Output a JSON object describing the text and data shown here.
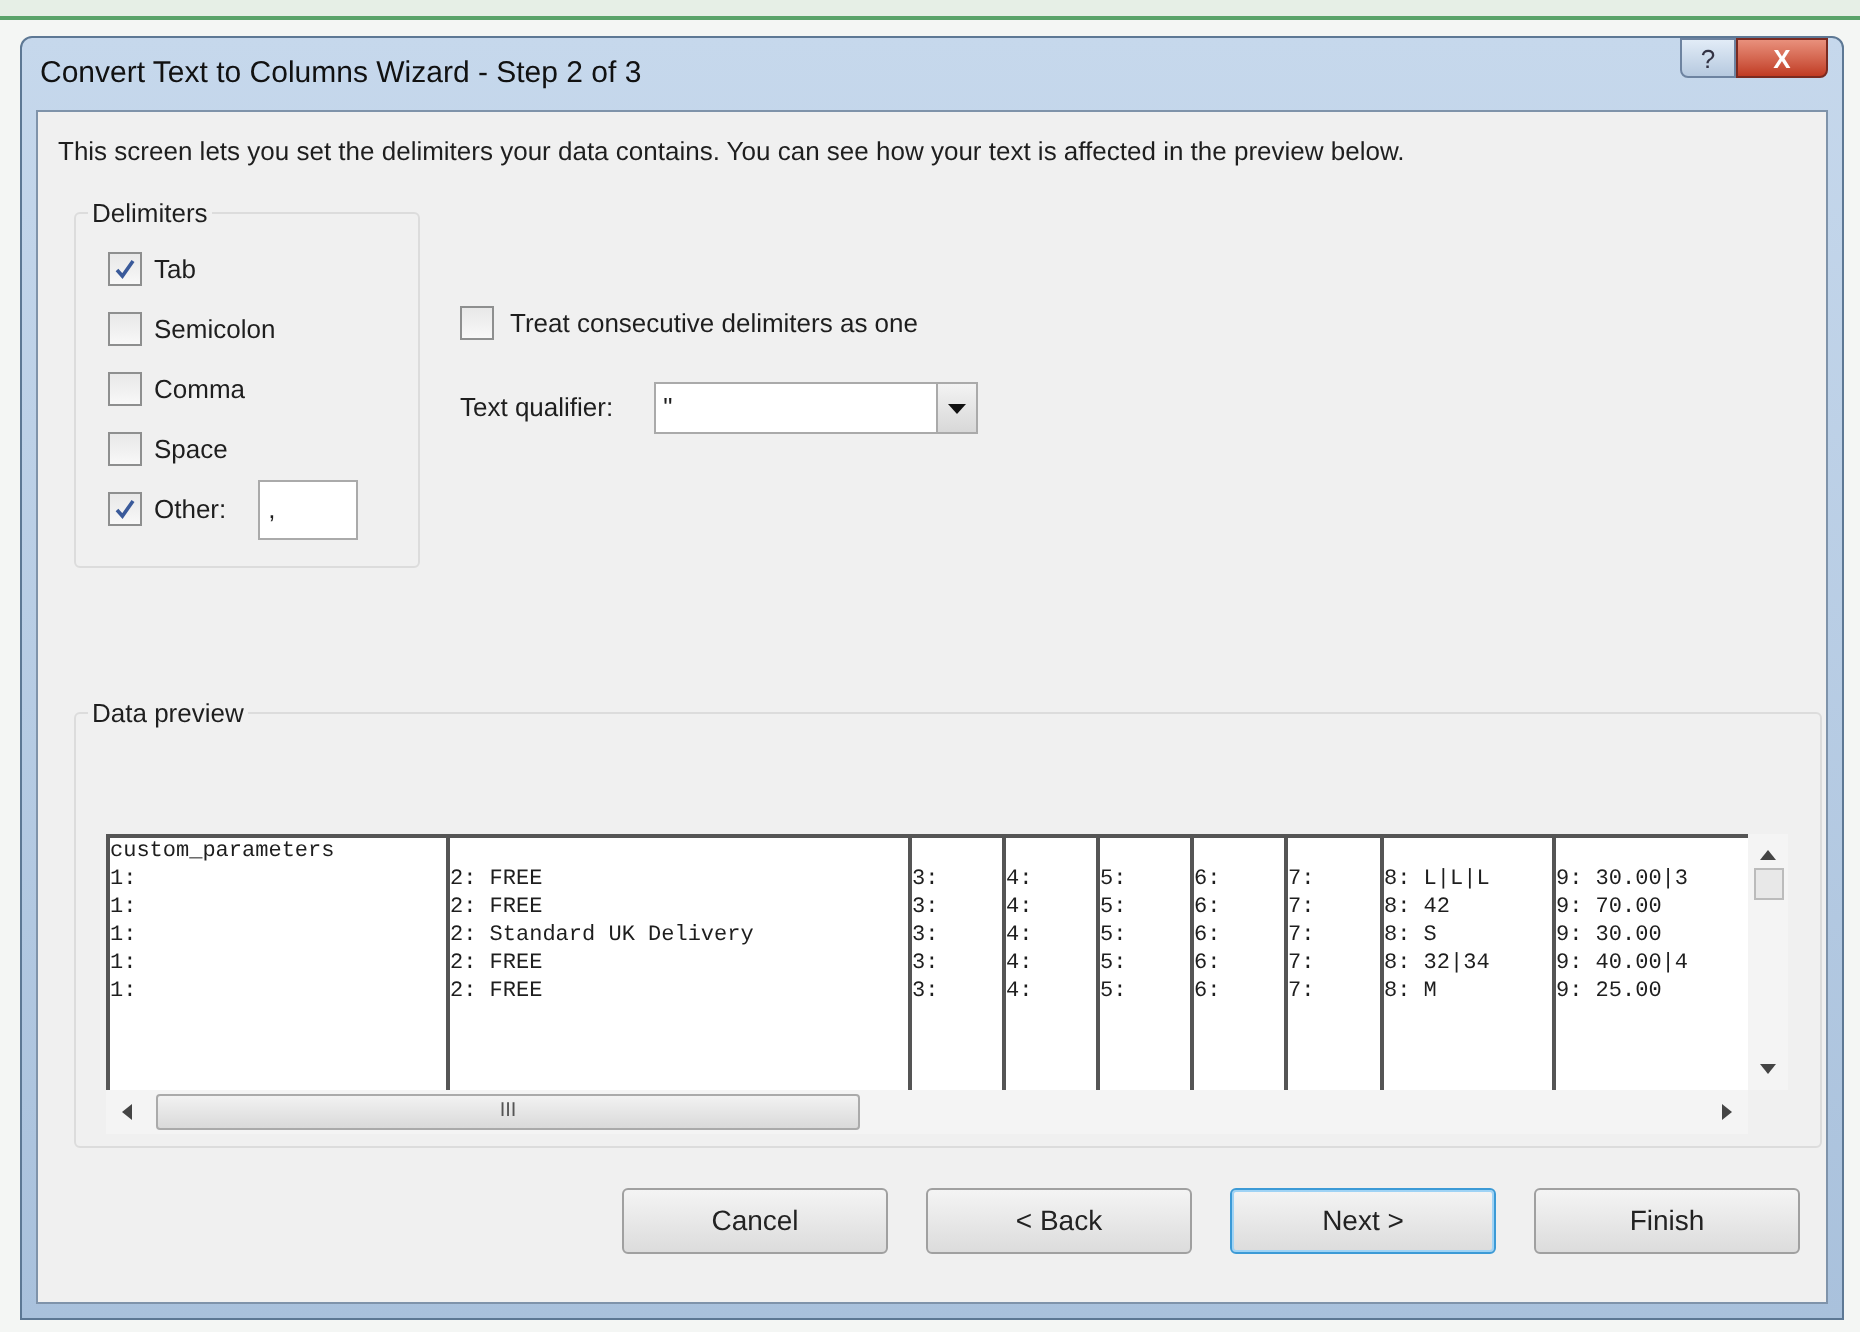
{
  "window": {
    "title": "Convert Text to Columns Wizard - Step 2 of 3",
    "help_glyph": "?",
    "close_glyph": "X"
  },
  "intro": "This screen lets you set the delimiters your data contains.  You can see how your text is affected in the preview below.",
  "delimiters": {
    "title": "Delimiters",
    "items": [
      {
        "label": "Tab",
        "checked": true
      },
      {
        "label": "Semicolon",
        "checked": false
      },
      {
        "label": "Comma",
        "checked": false
      },
      {
        "label": "Space",
        "checked": false
      },
      {
        "label": "Other:",
        "checked": true,
        "value": ","
      }
    ]
  },
  "treat_consecutive": {
    "label": "Treat consecutive delimiters as one",
    "checked": false
  },
  "text_qualifier": {
    "label": "Text qualifier:",
    "value": "\""
  },
  "preview": {
    "title": "Data preview",
    "header": "custom_parameters",
    "scroll_glyph": "III",
    "rows": [
      [
        "1:",
        "2: FREE",
        "3:",
        "4:",
        "5:",
        "6:",
        "7:",
        "8: L|L|L",
        "9: 30.00|3"
      ],
      [
        "1:",
        "2: FREE",
        "3:",
        "4:",
        "5:",
        "6:",
        "7:",
        "8: 42",
        "9: 70.00"
      ],
      [
        "1:",
        "2: Standard UK Delivery",
        "3:",
        "4:",
        "5:",
        "6:",
        "7:",
        "8: S",
        "9: 30.00"
      ],
      [
        "1:",
        "2: FREE",
        "3:",
        "4:",
        "5:",
        "6:",
        "7:",
        "8: 32|34",
        "9: 40.00|4"
      ],
      [
        "1:",
        "2: FREE",
        "3:",
        "4:",
        "5:",
        "6:",
        "7:",
        "8: M",
        "9: 25.00"
      ]
    ]
  },
  "buttons": [
    {
      "label": "Cancel",
      "default": false
    },
    {
      "label": "< Back",
      "default": false
    },
    {
      "label": "Next >",
      "default": true
    },
    {
      "label": "Finish",
      "default": false
    }
  ]
}
